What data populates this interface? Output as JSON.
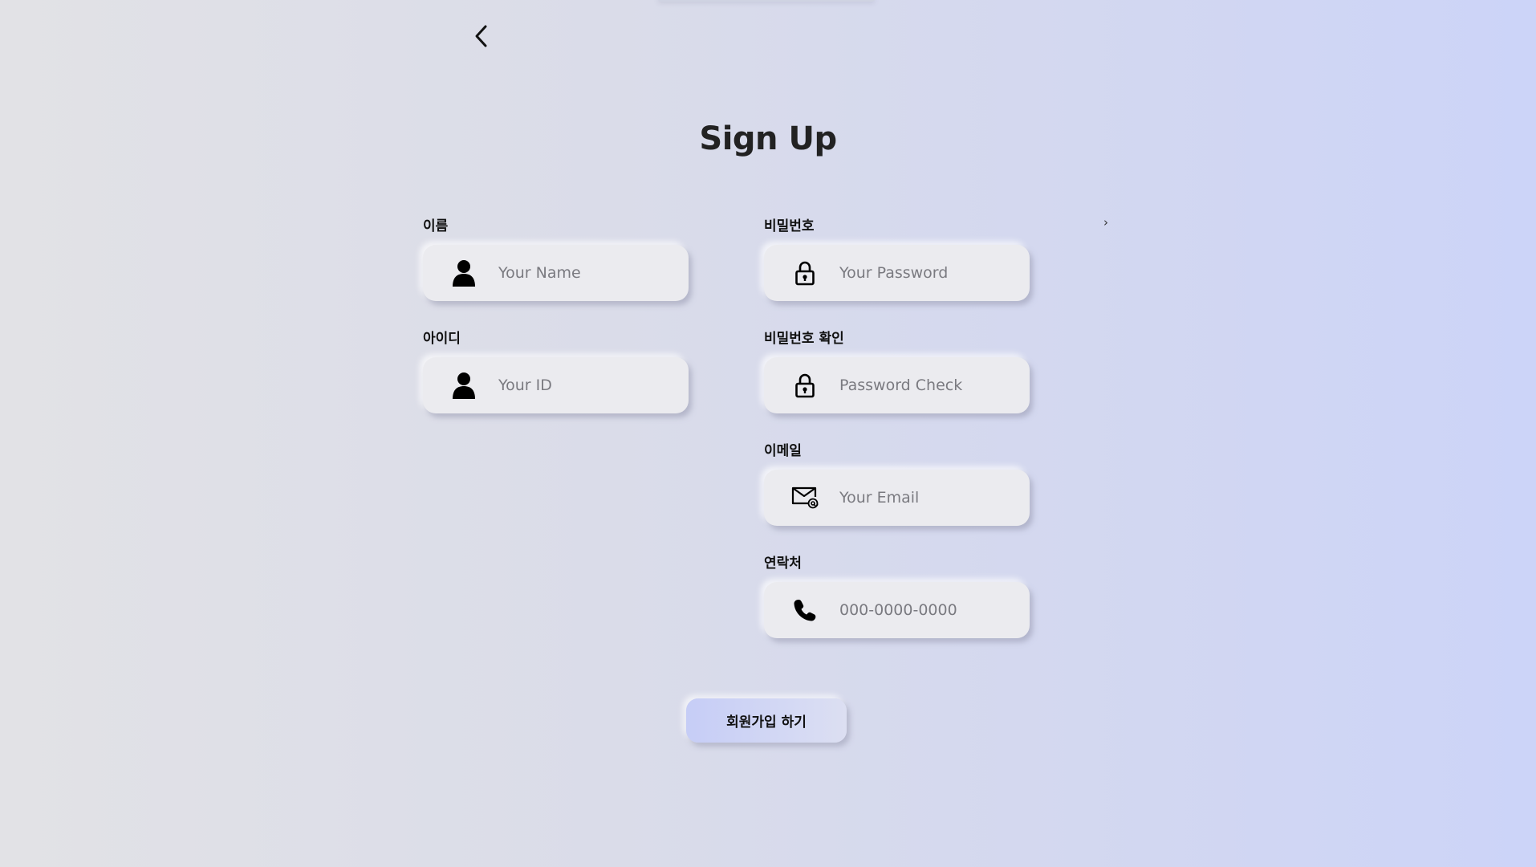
{
  "page": {
    "title": "Sign Up",
    "stray_glyph": "›"
  },
  "icons": {
    "back": "chevron-left-icon",
    "person": "person-icon",
    "lock": "lock-icon",
    "email": "envelope-at-icon",
    "phone": "phone-icon"
  },
  "form": {
    "name": {
      "label": "이름",
      "placeholder": "Your Name",
      "value": ""
    },
    "id": {
      "label": "아이디",
      "placeholder": "Your ID",
      "value": ""
    },
    "password": {
      "label": "비밀번호",
      "placeholder": "Your Password",
      "value": ""
    },
    "password_check": {
      "label": "비밀번호 확인",
      "placeholder": "Password Check",
      "value": ""
    },
    "email": {
      "label": "이메일",
      "placeholder": "Your Email",
      "value": ""
    },
    "phone": {
      "label": "연락처",
      "placeholder": "000-0000-0000",
      "value": ""
    },
    "submit_label": "회원가입 하기"
  },
  "colors": {
    "background_left": "#e2e2e6",
    "background_right": "#ccd4f8",
    "field_bg": "#ebebef",
    "button_bg": "#c6cdf6",
    "text": "#111111",
    "placeholder": "#7a7a80"
  }
}
